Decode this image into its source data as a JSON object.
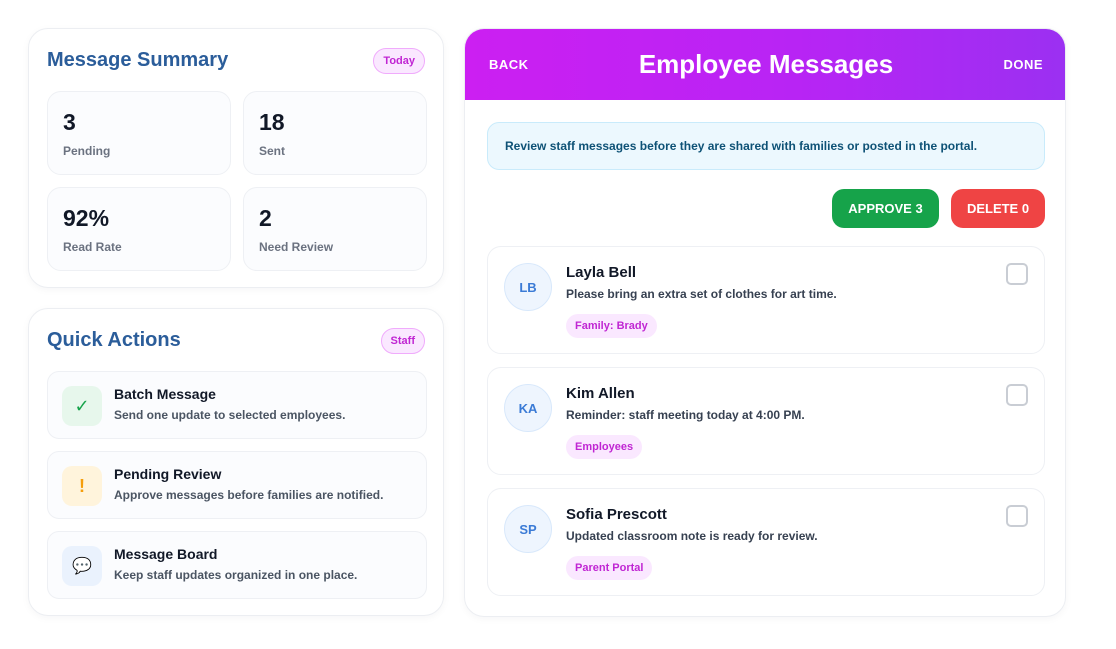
{
  "summary": {
    "title": "Message Summary",
    "badge": "Today",
    "stats": [
      {
        "value": "3",
        "label": "Pending"
      },
      {
        "value": "18",
        "label": "Sent"
      },
      {
        "value": "92%",
        "label": "Read Rate"
      },
      {
        "value": "2",
        "label": "Need Review"
      }
    ]
  },
  "quick_actions": {
    "title": "Quick Actions",
    "badge": "Staff",
    "items": [
      {
        "icon": "check-icon",
        "glyph": "✓",
        "title": "Batch Message",
        "subtitle": "Send one update to selected employees."
      },
      {
        "icon": "exclamation-icon",
        "glyph": "!",
        "title": "Pending Review",
        "subtitle": "Approve messages before families are notified."
      },
      {
        "icon": "speech-bubble-icon",
        "glyph": "💬",
        "title": "Message Board",
        "subtitle": "Keep staff updates organized in one place."
      }
    ]
  },
  "header": {
    "back_label": "BACK",
    "title": "Employee Messages",
    "done_label": "DONE"
  },
  "notice": "Review staff messages before they are shared with families or posted in the portal.",
  "actions": {
    "approve_label": "APPROVE 3",
    "delete_label": "DELETE 0"
  },
  "messages": [
    {
      "initials": "LB",
      "name": "Layla Bell",
      "text": "Please bring an extra set of clothes for art time.",
      "tag": "Family: Brady",
      "checked": false
    },
    {
      "initials": "KA",
      "name": "Kim Allen",
      "text": "Reminder: staff meeting today at 4:00 PM.",
      "tag": "Employees",
      "checked": false
    },
    {
      "initials": "SP",
      "name": "Sofia Prescott",
      "text": "Updated classroom note is ready for review.",
      "tag": "Parent Portal",
      "checked": false
    }
  ],
  "colors": {
    "header_gradient_start": "#cc1ff2",
    "header_gradient_end": "#9b30f2",
    "approve": "#16a34a",
    "delete": "#ef4444",
    "title_blue": "#2b5d9a",
    "tag_pink": "#c026d3"
  }
}
